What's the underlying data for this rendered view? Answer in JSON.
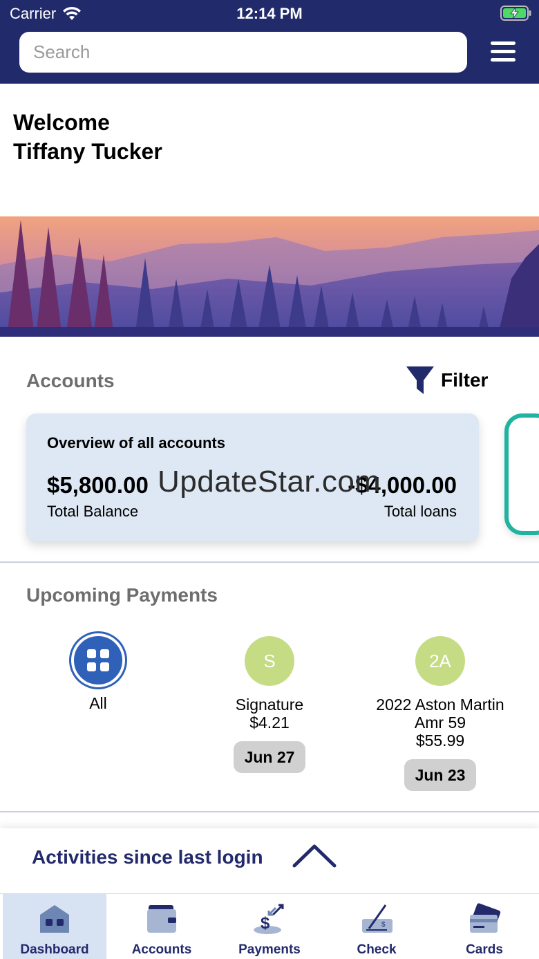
{
  "status_bar": {
    "carrier": "Carrier",
    "time": "12:14 PM"
  },
  "header": {
    "search_placeholder": "Search"
  },
  "welcome": {
    "line1": "Welcome",
    "line2": "Tiffany Tucker"
  },
  "accounts": {
    "title": "Accounts",
    "filter_label": "Filter",
    "overview": {
      "title": "Overview of all accounts",
      "total_balance": "$5,800.00",
      "total_balance_label": "Total Balance",
      "total_loans": "-$4,000.00",
      "total_loans_label": "Total loans"
    },
    "watermark": "UpdateStar.com"
  },
  "upcoming": {
    "title": "Upcoming Payments",
    "items": [
      {
        "initials": "",
        "name": "All",
        "amount": "",
        "date": ""
      },
      {
        "initials": "S",
        "name": "Signature",
        "amount": "$4.21",
        "date": "Jun 27"
      },
      {
        "initials": "2A",
        "name_line1": "2022 Aston Martin",
        "name_line2": "Amr 59",
        "amount": "$55.99",
        "date": "Jun 23"
      }
    ]
  },
  "activities": {
    "label": "Activities since last login"
  },
  "tabs": [
    {
      "label": "Dashboard",
      "icon": "house-icon",
      "active": true
    },
    {
      "label": "Accounts",
      "icon": "wallet-icon"
    },
    {
      "label": "Payments",
      "icon": "payment-transfer-icon"
    },
    {
      "label": "Check",
      "icon": "check-deposit-icon"
    },
    {
      "label": "Cards",
      "icon": "cards-icon"
    }
  ],
  "colors": {
    "header": "#212a6b",
    "accent": "#2f61b8",
    "card": "#dde8f4",
    "payee_circle": "#c5dc85",
    "next_card_border": "#1fb3a0"
  }
}
